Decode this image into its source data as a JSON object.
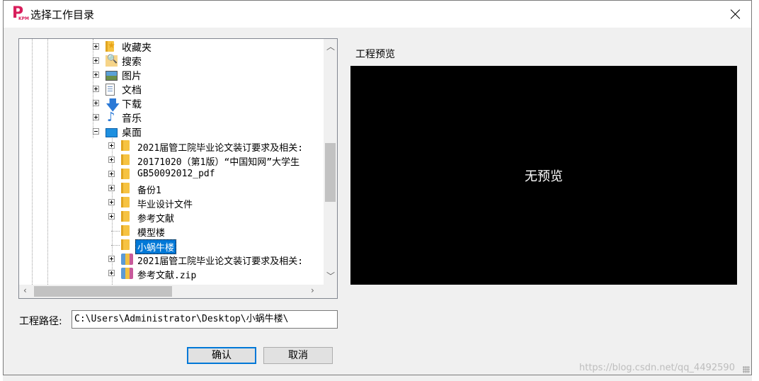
{
  "window": {
    "title": "选择工作目录",
    "app_icon_letter": "P",
    "app_icon_sub": "KPM"
  },
  "tree": {
    "items": [
      {
        "label": "收藏夹",
        "icon": "favorites-star-icon",
        "expander": "plus",
        "level": 1
      },
      {
        "label": "搜索",
        "icon": "search-folder-icon",
        "expander": "plus",
        "level": 1
      },
      {
        "label": "图片",
        "icon": "pictures-icon",
        "expander": "plus",
        "level": 1
      },
      {
        "label": "文档",
        "icon": "documents-icon",
        "expander": "plus",
        "level": 1
      },
      {
        "label": "下载",
        "icon": "downloads-arrow-icon",
        "expander": "plus",
        "level": 1
      },
      {
        "label": "音乐",
        "icon": "music-note-icon",
        "expander": "plus",
        "level": 1
      },
      {
        "label": "桌面",
        "icon": "desktop-icon",
        "expander": "minus",
        "level": 1
      },
      {
        "label": "2021届管工院毕业论文装订要求及相关:",
        "icon": "folder-icon",
        "expander": "plus",
        "level": 2
      },
      {
        "label": "20171020（第1版）“中国知网”大学生",
        "icon": "folder-icon",
        "expander": "plus",
        "level": 2
      },
      {
        "label": "GB50092012_pdf",
        "icon": "folder-icon",
        "expander": "plus",
        "level": 2
      },
      {
        "label": "备份1",
        "icon": "folder-icon",
        "expander": "plus",
        "level": 2
      },
      {
        "label": "毕业设计文件",
        "icon": "folder-icon",
        "expander": "plus",
        "level": 2
      },
      {
        "label": "参考文献",
        "icon": "folder-icon",
        "expander": "plus",
        "level": 2
      },
      {
        "label": "模型楼",
        "icon": "folder-icon",
        "expander": "none",
        "level": 2
      },
      {
        "label": "小蜗牛楼",
        "icon": "folder-icon",
        "expander": "none",
        "level": 2,
        "selected": true
      },
      {
        "label": "2021届管工院毕业论文装订要求及相关:",
        "icon": "zip-archive-icon",
        "expander": "plus",
        "level": 2
      },
      {
        "label": "参考文献.zip",
        "icon": "zip-archive-icon",
        "expander": "plus",
        "level": 2
      }
    ]
  },
  "preview": {
    "label": "工程预览",
    "empty_text": "无预览"
  },
  "path": {
    "label": "工程路径:",
    "value": "C:\\Users\\Administrator\\Desktop\\小蜗牛楼\\"
  },
  "buttons": {
    "ok": "确认",
    "cancel": "取消"
  },
  "watermark": "https://blog.csdn.net/qq_4492590"
}
